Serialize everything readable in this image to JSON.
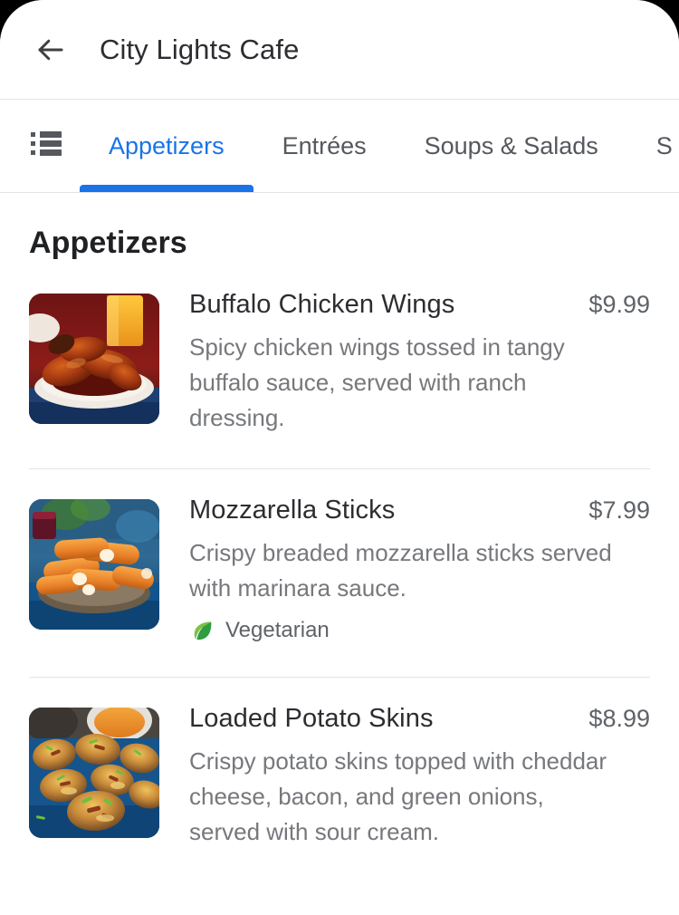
{
  "appbar": {
    "back_icon": "arrow-back-icon",
    "title": "City Lights Cafe"
  },
  "tabbar": {
    "list_icon": "list-view-icon",
    "active_tab": "Appetizers",
    "accent_color": "#1a73e8",
    "tabs": [
      {
        "label": "Appetizers",
        "active": true
      },
      {
        "label": "Entrées",
        "active": false
      },
      {
        "label": "Soups & Salads",
        "active": false
      },
      {
        "label": "S",
        "active": false
      }
    ]
  },
  "menu": {
    "section_title": "Appetizers",
    "items": [
      {
        "name": "Buffalo Chicken Wings",
        "price": "$9.99",
        "description": "Spicy chicken wings tossed in tangy buffalo sauce, served with ranch dressing.",
        "image_alt": "buffalo-chicken-wings-photo",
        "tags": []
      },
      {
        "name": "Mozzarella Sticks",
        "price": "$7.99",
        "description": "Crispy breaded mozzarella sticks served with marinara sauce.",
        "image_alt": "mozzarella-sticks-photo",
        "tags": [
          {
            "label": "Vegetarian",
            "icon": "leaf-icon",
            "color": "#34a853"
          }
        ]
      },
      {
        "name": "Loaded Potato Skins",
        "price": "$8.99",
        "description": "Crispy potato skins topped with cheddar cheese, bacon, and green onions, served with sour cream.",
        "image_alt": "loaded-potato-skins-photo",
        "tags": []
      }
    ]
  }
}
